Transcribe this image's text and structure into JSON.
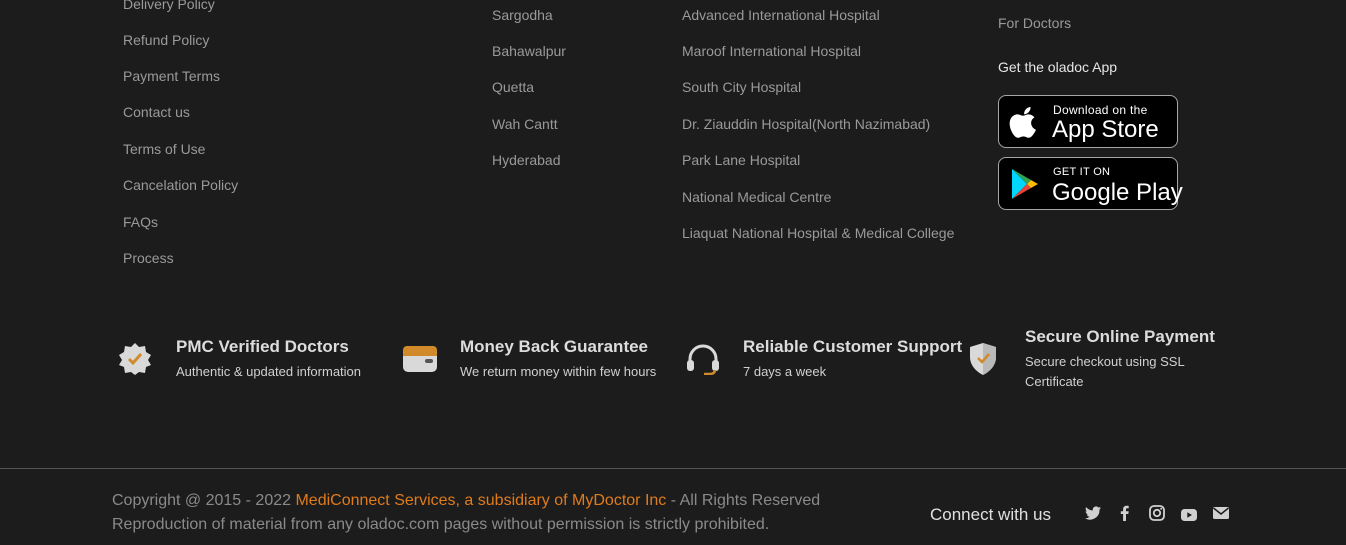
{
  "policy_links": [
    "Delivery Policy",
    "Refund Policy",
    "Payment Terms",
    "Contact us",
    "Terms of Use",
    "Cancelation Policy",
    "FAQs",
    "Process"
  ],
  "city_links": [
    "Sargodha",
    "Bahawalpur",
    "Quetta",
    "Wah Cantt",
    "Hyderabad"
  ],
  "hospital_links": [
    "Advanced International Hospital",
    "Maroof International Hospital",
    "South City Hospital",
    "Dr. Ziauddin Hospital(North Nazimabad)",
    "Park Lane Hospital",
    "National Medical Centre",
    "Liaquat National Hospital & Medical College"
  ],
  "app_section": {
    "for_doctors": "For Doctors",
    "heading": "Get the oladoc App",
    "app_store": {
      "small": "Download on the",
      "big": "App Store",
      "icon": "apple-icon"
    },
    "google_play": {
      "small": "GET IT ON",
      "big": "Google Play",
      "icon": "google-play-icon"
    }
  },
  "features": [
    {
      "title": "PMC Verified Doctors",
      "subtitle": "Authentic & updated information",
      "icon": "verified-badge-icon"
    },
    {
      "title": "Money Back Guarantee",
      "subtitle": "We return money within few hours",
      "icon": "wallet-icon"
    },
    {
      "title": "Reliable Customer Support",
      "subtitle": "7 days a week",
      "icon": "headset-icon"
    },
    {
      "title": "Secure Online Payment",
      "subtitle_line1": "Secure checkout using SSL",
      "subtitle_line2": "Certificate",
      "icon": "shield-check-icon"
    }
  ],
  "footer": {
    "copyright_prefix": "Copyright @ 2015 - 2022 ",
    "copyright_brand": "MediConnect Services, a subsidiary of MyDoctor Inc",
    "copyright_suffix": " - All Rights Reserved",
    "reproduction": "Reproduction of material from any oladoc.com pages without permission is strictly prohibited.",
    "connect_label": "Connect with us",
    "social_icons": [
      "twitter-icon",
      "facebook-icon",
      "instagram-icon",
      "youtube-icon",
      "email-icon"
    ]
  },
  "colors": {
    "background": "#1c1c1c",
    "accent": "#e07b1c",
    "link": "#9a9a9a"
  }
}
